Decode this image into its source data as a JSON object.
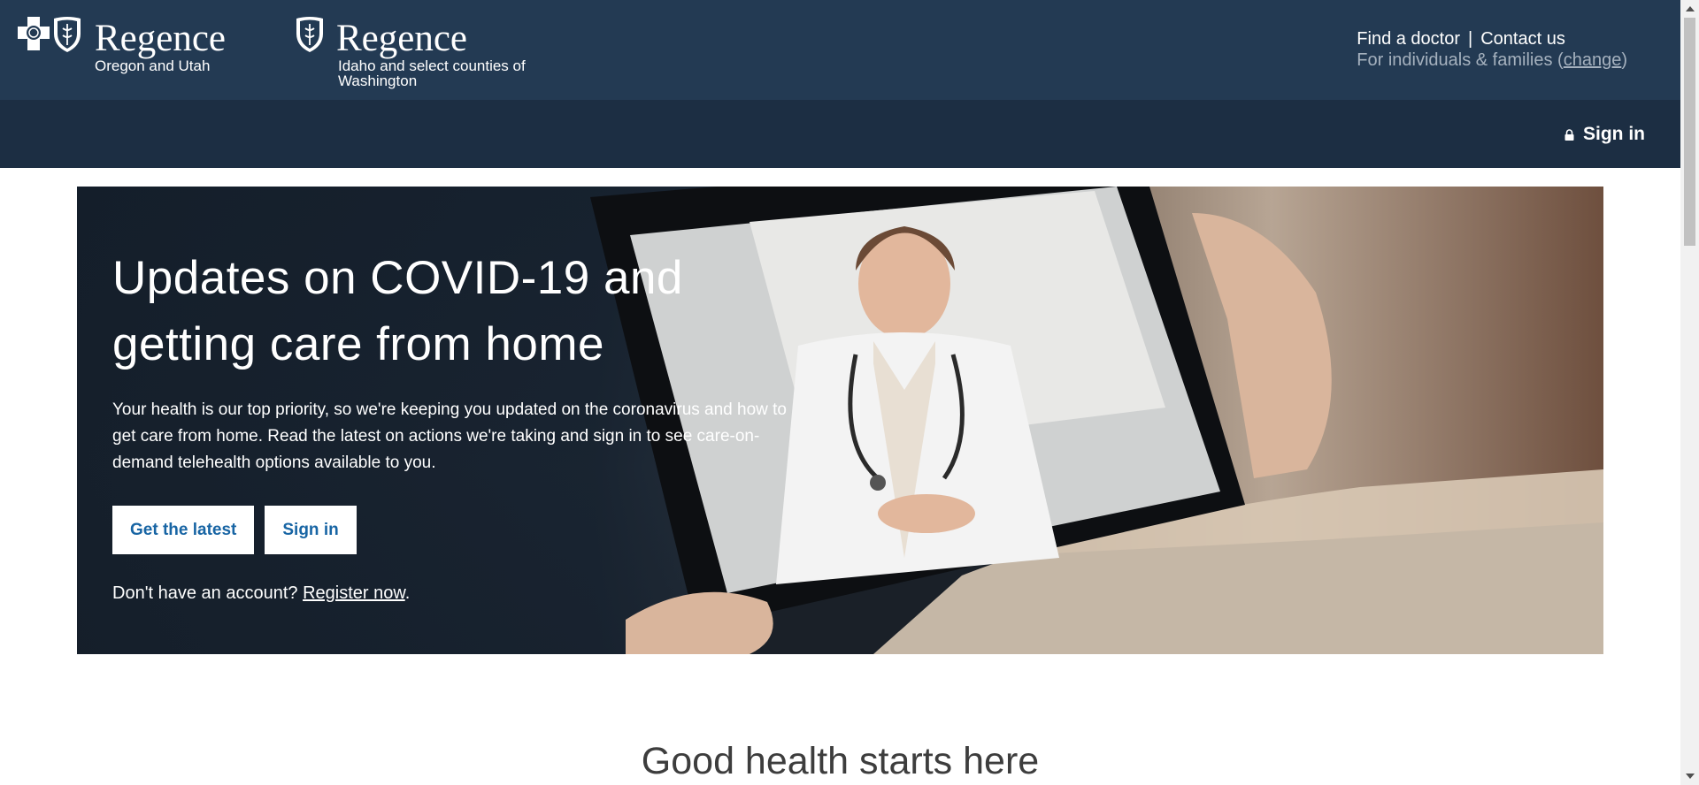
{
  "header": {
    "logos": [
      {
        "brand": "Regence",
        "region": "Oregon and Utah",
        "icons": [
          "blue-cross-icon",
          "blue-shield-icon"
        ]
      },
      {
        "brand": "Regence",
        "region": "Idaho and select counties of Washington",
        "icons": [
          "blue-shield-icon"
        ]
      }
    ],
    "utility": {
      "find_doctor": "Find a doctor",
      "separator": "|",
      "contact_us": "Contact us",
      "audience_prefix": "For individuals & families (",
      "change_link": "change",
      "audience_suffix": ")"
    }
  },
  "nav": {
    "sign_in": "Sign in",
    "sign_in_icon": "lock-icon"
  },
  "hero": {
    "title_line1": "Updates on COVID-19 and",
    "title_line2": "getting care from home",
    "body": "Your health is our top priority, so we're keeping you updated on the coronavirus and how to get care from home. Read the latest on actions we're taking and sign in to see care-on-demand telehealth options available to you.",
    "button_latest": "Get the latest",
    "button_signin": "Sign in",
    "register_prefix": "Don't have an account? ",
    "register_link": "Register now",
    "register_suffix": "."
  },
  "section": {
    "title": "Good health starts here"
  },
  "colors": {
    "header_bg": "#233a53",
    "nav_bg": "#1c2e43",
    "button_text": "#1865a4",
    "muted_text": "#a5b1be"
  }
}
